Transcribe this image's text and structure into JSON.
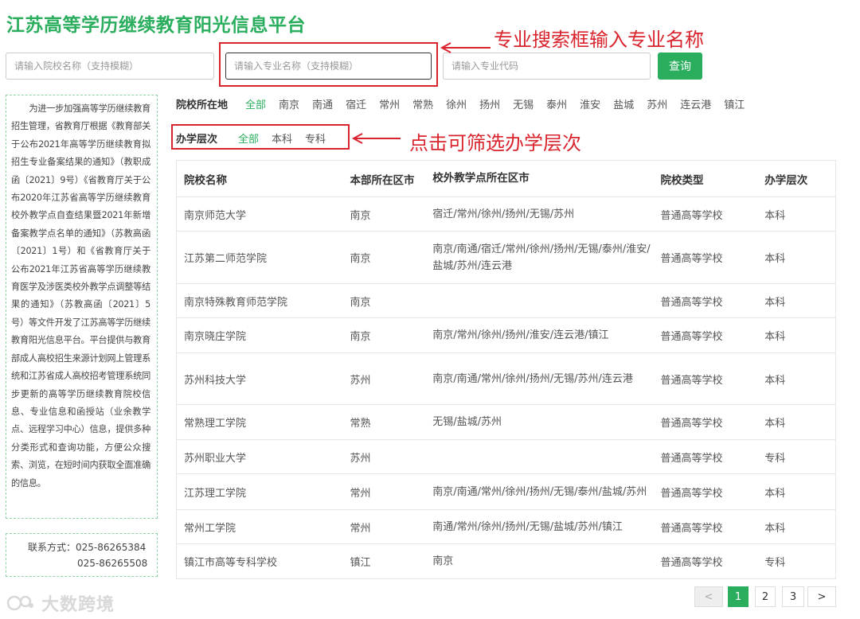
{
  "title": "江苏高等学历继续教育阳光信息平台",
  "search": {
    "school_placeholder": "请输入院校名称（支持模糊）",
    "major_placeholder": "请输入专业名称（支持模糊）",
    "code_placeholder": "请输入专业代码",
    "button": "查询"
  },
  "annotations": {
    "search_note": "专业搜索框输入专业名称",
    "level_note": "点击可筛选办学层次",
    "color": "#d9232d"
  },
  "intro": "为进一步加强高等学历继续教育招生管理，省教育厅根据《教育部关于公布2021年高等学历继续教育拟招生专业备案结果的通知》（教职成函〔2021〕9号）《省教育厅关于公布2020年江苏省高等学历继续教育校外教学点自查结果暨2021年新增备案教学点名单的通知》（苏教高函〔2021〕1号）和《省教育厅关于公布2021年江苏省高等学历继续教育医学及涉医类校外教学点调整等结果的通知》（苏教高函〔2021〕5号）等文件开发了江苏高等学历继续教育阳光信息平台。平台提供与教育部成人高校招生来源计划网上管理系统和江苏省成人高校招考管理系统同步更新的高等学历继续教育院校信息、专业信息和函授站（业余教学点、远程学习中心）信息，提供多种分类形式和查询功能，方便公众搜索、浏览，在短时间内获取全面准确的信息。",
  "contact": {
    "line1": "联系方式：025-86265384",
    "line2": "025-86265508"
  },
  "filters": {
    "location": {
      "label": "院校所在地",
      "options": [
        "全部",
        "南京",
        "南通",
        "宿迁",
        "常州",
        "常熟",
        "徐州",
        "扬州",
        "无锡",
        "泰州",
        "淮安",
        "盐城",
        "苏州",
        "连云港",
        "镇江"
      ]
    },
    "level": {
      "label": "办学层次",
      "options": [
        "全部",
        "本科",
        "专科"
      ]
    }
  },
  "table": {
    "headers": [
      "院校名称",
      "本部所在区市",
      "校外教学点所在区市",
      "院校类型",
      "办学层次"
    ],
    "rows": [
      [
        "南京师范大学",
        "南京",
        "宿迁/常州/徐州/扬州/无锡/苏州",
        "普通高等学校",
        "本科"
      ],
      [
        "江苏第二师范学院",
        "南京",
        "南京/南通/宿迁/常州/徐州/扬州/无锡/泰州/淮安/盐城/苏州/连云港",
        "普通高等学校",
        "本科"
      ],
      [
        "南京特殊教育师范学院",
        "南京",
        "",
        "普通高等学校",
        "本科"
      ],
      [
        "南京晓庄学院",
        "南京",
        "南京/常州/徐州/扬州/淮安/连云港/镇江",
        "普通高等学校",
        "本科"
      ],
      [
        "苏州科技大学",
        "苏州",
        "南京/南通/常州/徐州/扬州/无锡/苏州/连云港",
        "普通高等学校",
        "本科"
      ],
      [
        "常熟理工学院",
        "常熟",
        "无锡/盐城/苏州",
        "普通高等学校",
        "本科"
      ],
      [
        "苏州职业大学",
        "苏州",
        "",
        "普通高等学校",
        "专科"
      ],
      [
        "江苏理工学院",
        "常州",
        "南京/南通/常州/徐州/扬州/无锡/泰州/盐城/苏州",
        "普通高等学校",
        "本科"
      ],
      [
        "常州工学院",
        "常州",
        "南通/常州/徐州/扬州/无锡/盐城/苏州/镇江",
        "普通高等学校",
        "本科"
      ],
      [
        "镇江市高等专科学校",
        "镇江",
        "南京",
        "普通高等学校",
        "专科"
      ]
    ]
  },
  "pagination": {
    "prev": "<",
    "pages": [
      "1",
      "2",
      "3"
    ],
    "next": ">",
    "current": "1"
  },
  "watermark": "大数跨境",
  "colors": {
    "accent": "#2aae5e",
    "annotation": "#d9232d"
  }
}
